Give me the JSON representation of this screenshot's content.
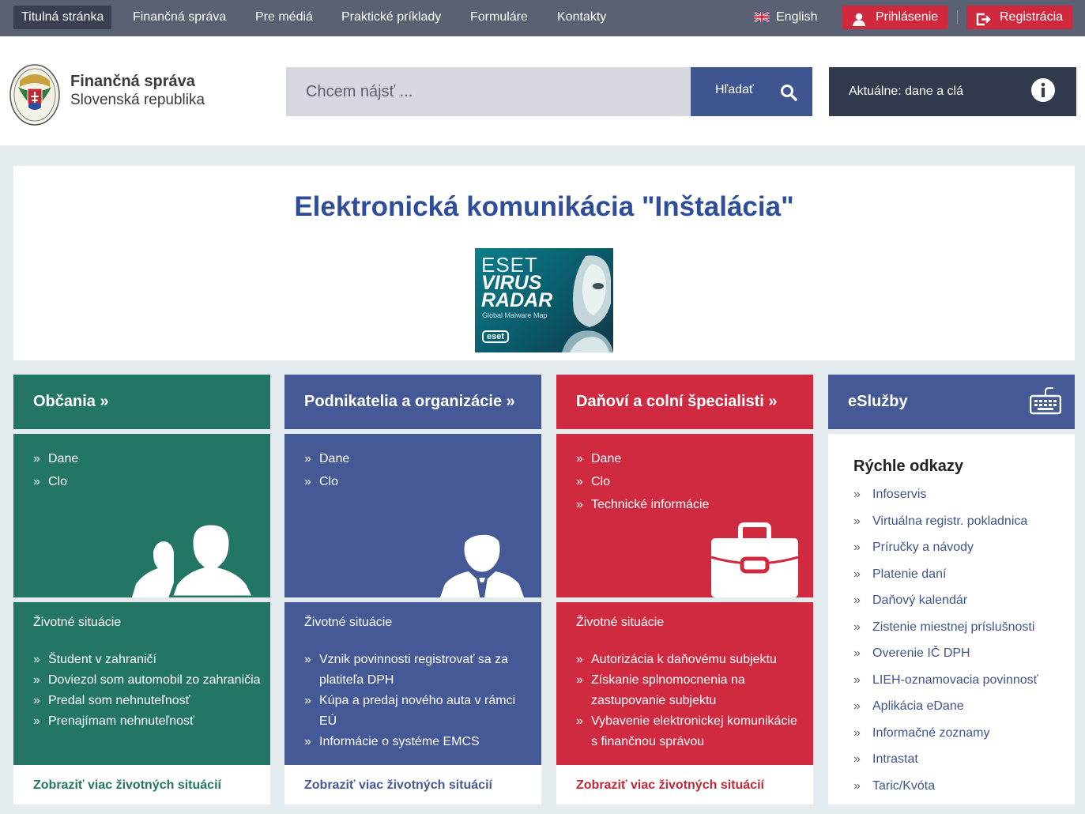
{
  "topnav": {
    "items": [
      "Titulná stránka",
      "Finančná správa",
      "Pre médiá",
      "Praktické príklady",
      "Formuláre",
      "Kontakty"
    ],
    "language": "English",
    "login": "Prihlásenie",
    "register": "Registrácia"
  },
  "header": {
    "logo_line1": "Finančná správa",
    "logo_line2": "Slovenská republika",
    "search_placeholder": "Chcem nájsť ...",
    "search_button": "Hľadať",
    "news_button": "Aktuálne: dane a clá"
  },
  "banner": {
    "title": "Elektronická komunikácia \"Inštalácia\"",
    "ad": {
      "line1": "ESET",
      "line2": "VIRUS",
      "line3": "RADAR",
      "line4": "Global Malware Map",
      "brand": "eset"
    }
  },
  "columns": [
    {
      "heading": "Občania »",
      "links": [
        "Dane",
        "Clo"
      ],
      "life_title": "Životné situácie",
      "life_items": [
        "Študent v zahraničí",
        "Doviezol som automobil zo zahraničia",
        "Predal som nehnuteľnosť",
        "Prenajímam nehnuteľnosť"
      ],
      "more": "Zobraziť viac životných situácií",
      "color": "#237564",
      "icon": "people-icon"
    },
    {
      "heading": "Podnikatelia a organizácie »",
      "links": [
        "Dane",
        "Clo"
      ],
      "life_title": "Životné situácie",
      "life_items": [
        "Vznik povinnosti registrovať sa za platiteľa DPH",
        "Kúpa a predaj nového auta v rámci EÚ",
        "Informácie o systéme EMCS"
      ],
      "more": "Zobraziť viac životných situácií",
      "color": "#455996",
      "icon": "businessman-icon"
    },
    {
      "heading": "Daňoví a colní špecialisti »",
      "links": [
        "Dane",
        "Clo",
        "Technické informácie"
      ],
      "life_title": "Životné situácie",
      "life_items": [
        "Autorizácia k daňovému subjektu",
        "Získanie splnomocnenia na zastupovanie subjektu",
        "Vybavenie elektronickej komunikácie s finančnou správou"
      ],
      "more": "Zobraziť viac životných situácií",
      "color": "#d02a41",
      "icon": "briefcase-icon"
    }
  ],
  "esluzby": {
    "heading": "eSlužby",
    "title": "Rýchle odkazy",
    "links": [
      "Infoservis",
      "Virtuálna registr. pokladnica",
      "Príručky a návody",
      "Platenie daní",
      "Daňový kalendár",
      "Zistenie miestnej príslušnosti",
      "Overenie IČ DPH",
      "LIEH-oznamovacia povinnosť",
      "Aplikácia eDane",
      "Informačné zoznamy",
      "Intrastat",
      "Taric/Kvóta"
    ]
  }
}
